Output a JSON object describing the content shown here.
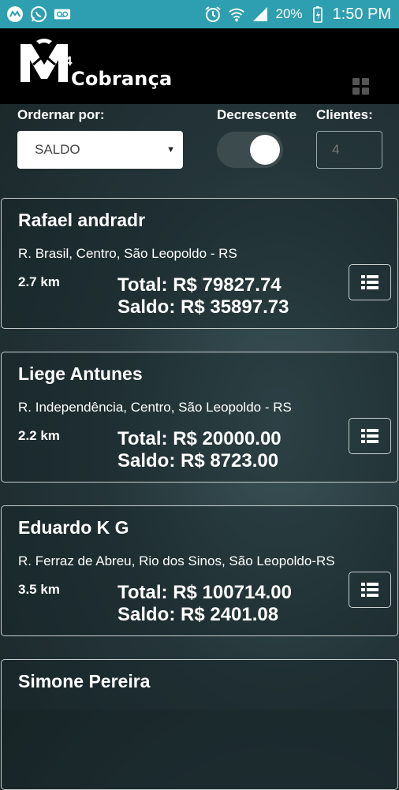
{
  "status_bar": {
    "icons_left": [
      "messenger-icon",
      "whatsapp-icon",
      "voicemail-icon"
    ],
    "battery": "20%",
    "time": "1:50 PM"
  },
  "app": {
    "logo_text": "Cobrança",
    "logo_superscript": "4"
  },
  "controls": {
    "order_label": "Ordernar por:",
    "order_value": "SALDO",
    "desc_label": "Decrescente",
    "desc_on": true,
    "clients_label": "Clientes:",
    "clients_value": "4"
  },
  "clients": [
    {
      "name": "Rafael andradr",
      "address": "R. Brasil, Centro, São Leopoldo - RS",
      "distance": "2.7 km",
      "total": "Total: R$ 79827.74",
      "saldo": "Saldo: R$ 35897.73"
    },
    {
      "name": "Liege Antunes",
      "address": "R. Independência, Centro, São Leopoldo - RS",
      "distance": "2.2 km",
      "total": "Total: R$ 20000.00",
      "saldo": "Saldo: R$ 8723.00"
    },
    {
      "name": "Eduardo K G",
      "address": "R. Ferraz de Abreu, Rio dos Sinos, São Leopoldo-RS",
      "distance": "3.5 km",
      "total": "Total: R$ 100714.00",
      "saldo": "Saldo: R$ 2401.08"
    },
    {
      "name": "Simone Pereira",
      "address": "",
      "distance": "",
      "total": "",
      "saldo": ""
    }
  ]
}
